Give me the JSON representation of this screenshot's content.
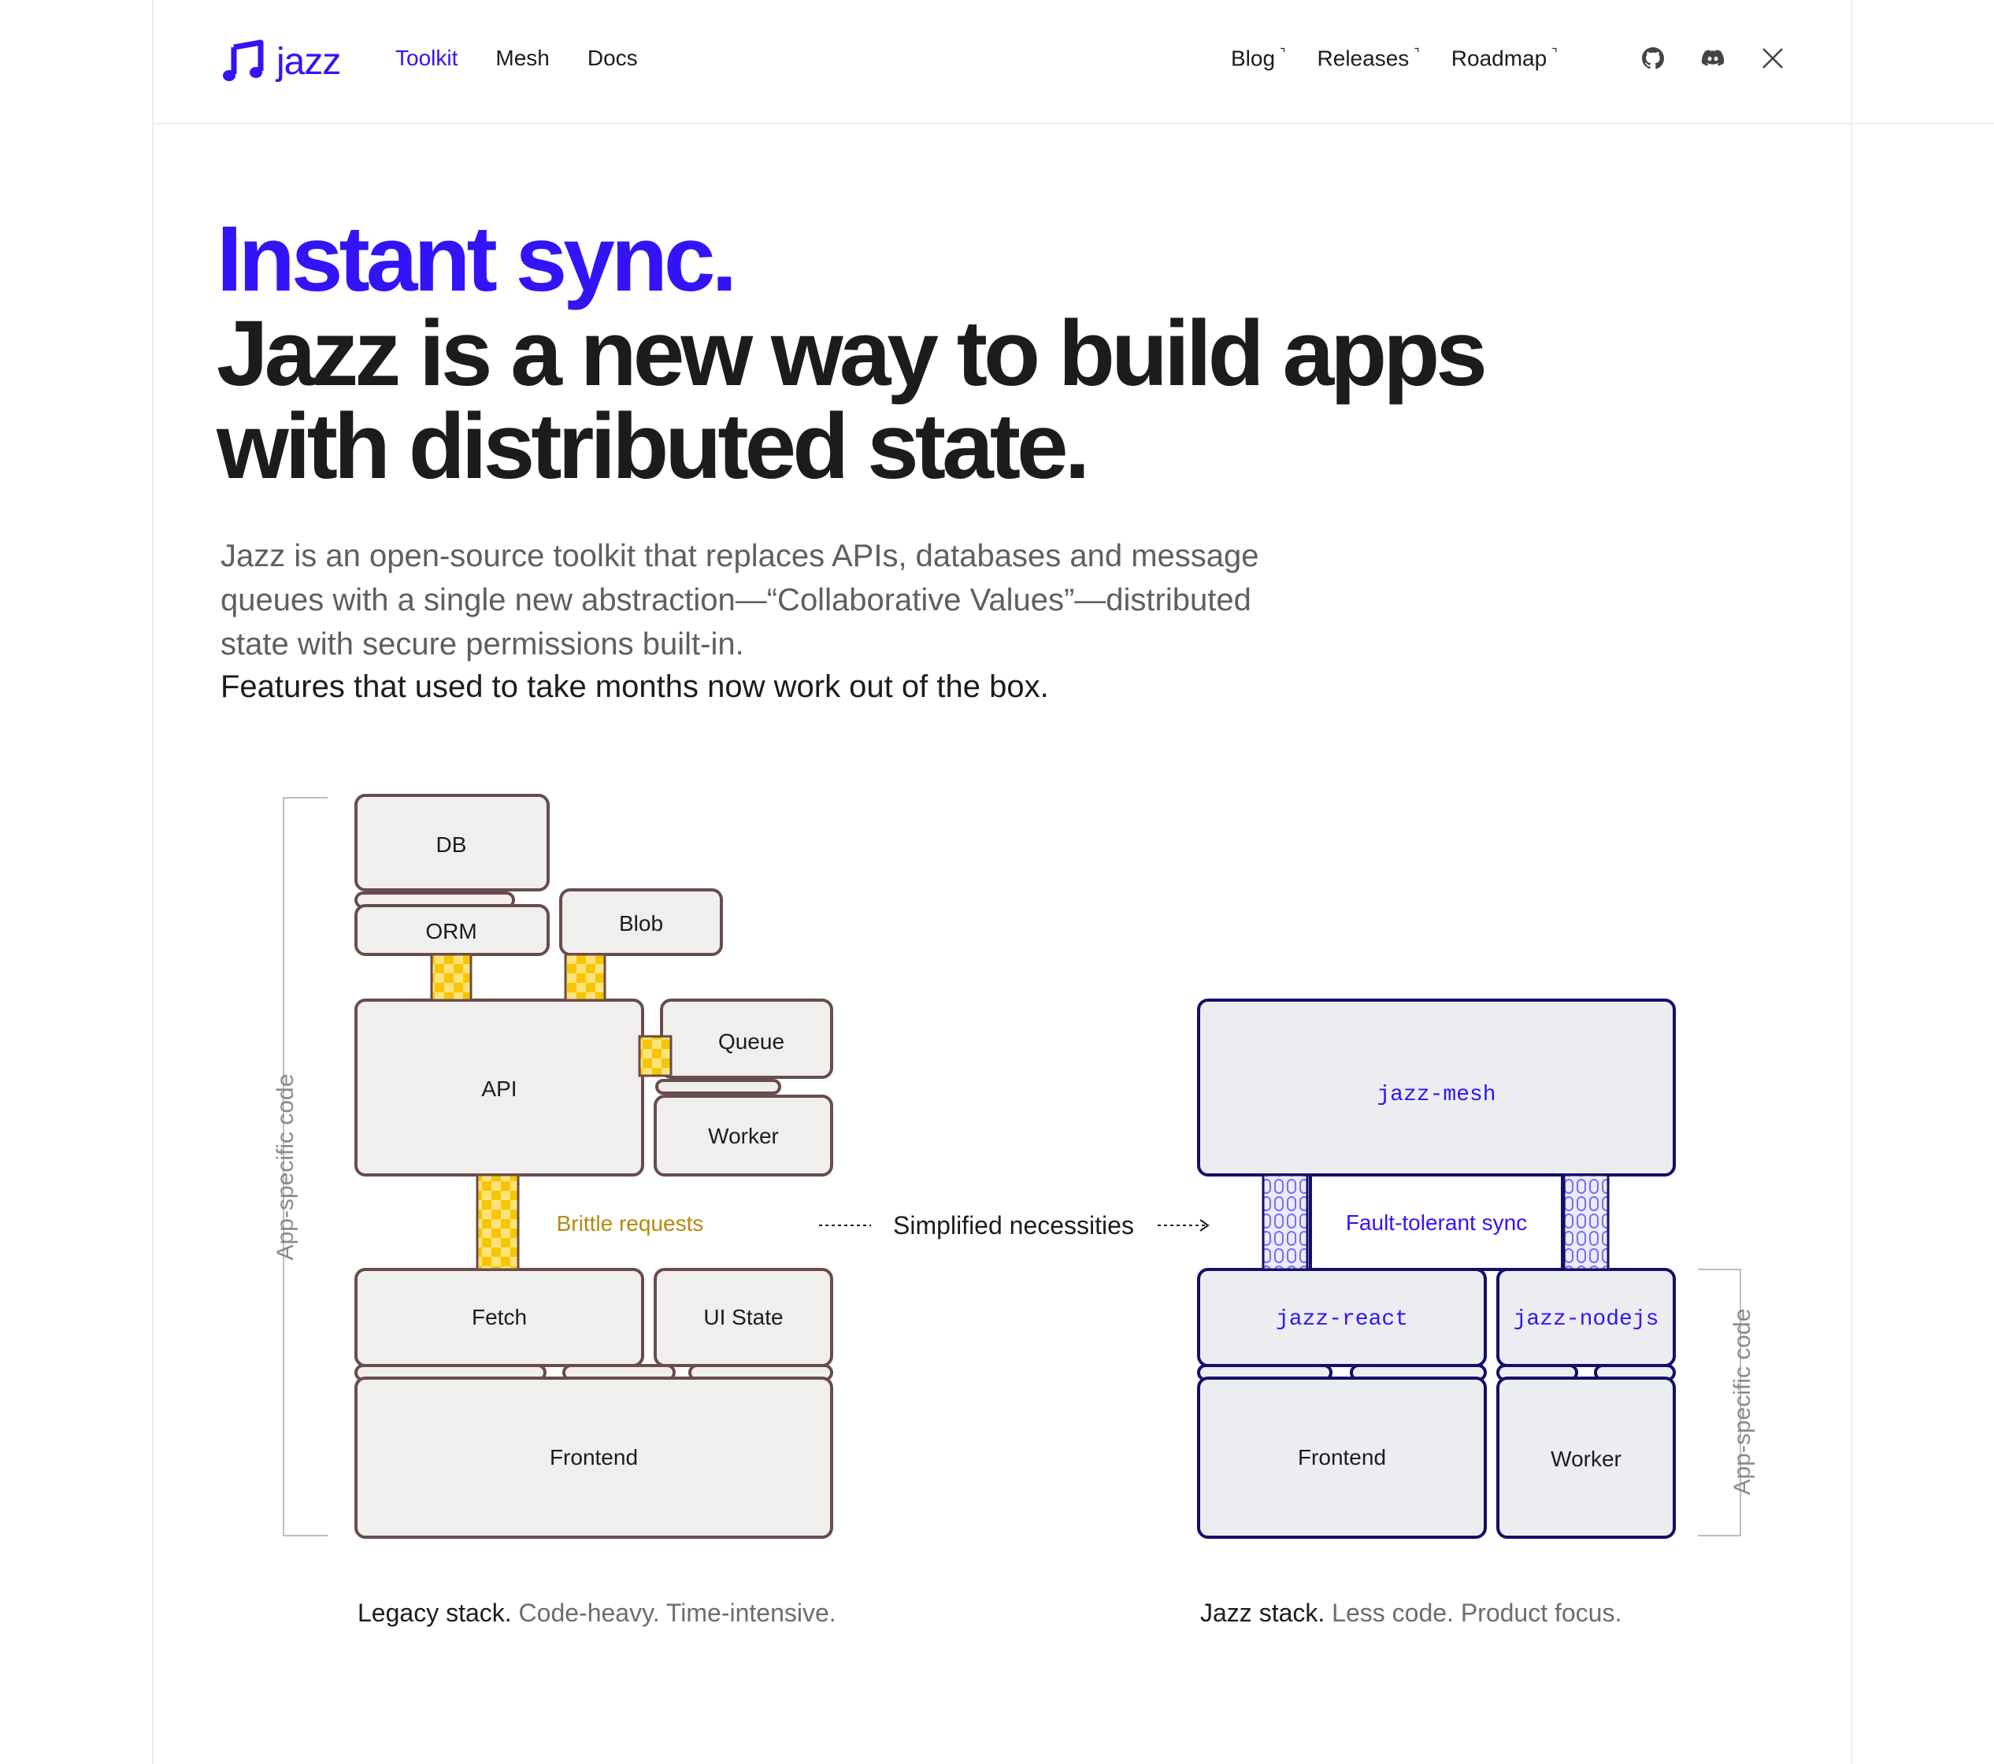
{
  "header": {
    "logo_text": "jazz",
    "nav_left": [
      "Toolkit",
      "Mesh",
      "Docs"
    ],
    "nav_right": [
      "Blog",
      "Releases",
      "Roadmap"
    ],
    "external_mark": "¬",
    "social_icons": [
      "github-icon",
      "discord-icon",
      "x-icon"
    ]
  },
  "hero": {
    "line1": "Instant sync.",
    "line2": "Jazz is a new way to build apps with distributed state.",
    "lead": "Jazz is an open-source toolkit that replaces APIs, databases and message queues with a single new abstraction—“Collaborative Values”—distributed state with secure permissions built-in.",
    "lead_strong": "Features that used to take months now work out of the box."
  },
  "legacy": {
    "side_label": "App-specific code",
    "blocks": [
      "DB",
      "ORM",
      "Blob",
      "Queue",
      "API",
      "Worker",
      "Fetch",
      "UI State",
      "Frontend"
    ],
    "brittle_label": "Brittle requests",
    "caption_bold": "Legacy stack.",
    "caption_dim": "Code-heavy. Time-intensive."
  },
  "arrow_label": "Simplified necessities",
  "jazz": {
    "side_label": "App-specific code",
    "mesh": "jazz-mesh",
    "sync": "Fault-tolerant sync",
    "react": "jazz-react",
    "nodejs": "jazz-nodejs",
    "frontend": "Frontend",
    "worker": "Worker",
    "caption_bold": "Jazz stack.",
    "caption_dim": "Less code. Product focus."
  },
  "colors": {
    "accent": "#3313f7",
    "legacy_stroke": "#6a4c4c",
    "legacy_fill": "#f1eeee",
    "jazz_stroke": "#140f6b",
    "jazz_fill": "#ecedf1",
    "brittle": "#b58a10",
    "checker": "#f7c600"
  }
}
